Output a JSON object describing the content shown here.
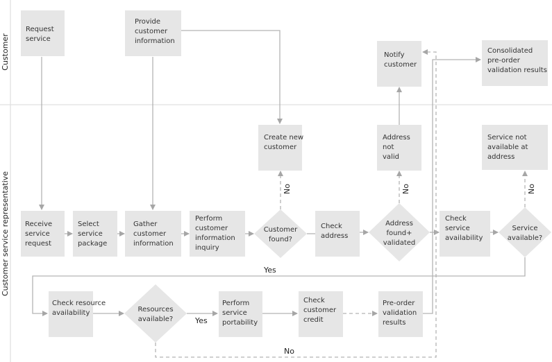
{
  "lanes": [
    "Customer",
    "Customer service representative"
  ],
  "nodes": {
    "request_service": [
      "Request",
      "service"
    ],
    "provide_info": [
      "Provide",
      "customer",
      "information"
    ],
    "notify_customer": [
      "Notify",
      "customer"
    ],
    "consolidated": [
      "Consolidated",
      "pre-order",
      "validation results"
    ],
    "create_customer": [
      "Create new",
      "customer"
    ],
    "address_not_valid": [
      "Address",
      "not",
      "valid"
    ],
    "service_not_available": [
      "Service not",
      "available at",
      "address"
    ],
    "receive_request": [
      "Receive",
      "service",
      "request"
    ],
    "select_package": [
      "Select",
      "service",
      "package"
    ],
    "gather_info": [
      "Gather",
      "customer",
      "information"
    ],
    "perform_inquiry": [
      "Perform",
      "customer",
      "information",
      "inquiry"
    ],
    "customer_found": [
      "Customer",
      "found?"
    ],
    "check_address": [
      "Check",
      "address"
    ],
    "address_validated": [
      "Address",
      "found+",
      "validated"
    ],
    "check_service": [
      "Check",
      "service",
      "availability"
    ],
    "service_available": [
      "Service",
      "available?"
    ],
    "check_resource": [
      "Check resource",
      "availability"
    ],
    "resources_available": [
      "Resources",
      "available?"
    ],
    "service_portability": [
      "Perform",
      "service",
      "portability"
    ],
    "check_credit": [
      "Check",
      "customer",
      "credit"
    ],
    "preorder_results": [
      "Pre-order",
      "validation",
      "results"
    ]
  },
  "edge_labels": {
    "yes_service": "Yes",
    "yes_resources": "Yes",
    "no_resources": "No",
    "no_customer": "No",
    "no_address": "No",
    "no_service": "No"
  },
  "colors": {
    "node_fill": "#e6e6e6",
    "edge": "#b3b3b3",
    "lane_line": "#e0e0e0"
  }
}
